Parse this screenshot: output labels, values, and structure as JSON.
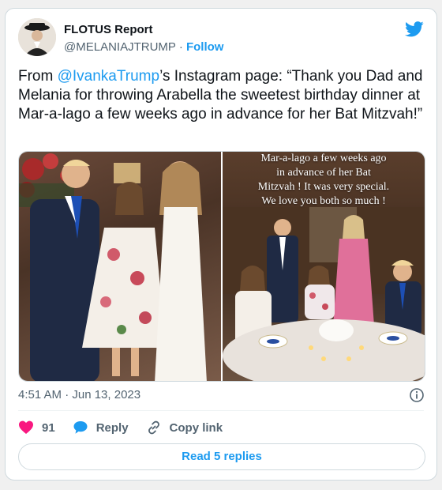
{
  "author": {
    "display_name": "FLOTUS Report",
    "handle": "@MELANIAJTRUMP",
    "separator": "·",
    "follow_label": "Follow",
    "avatar_icon": "user-avatar-icon"
  },
  "tweet": {
    "text_before": "From ",
    "mention": "@IvankaTrump",
    "text_after": "’s Instagram page: “Thank you Dad and Melania for throwing Arabella the sweetest birthday dinner at Mar-a-lago a few weeks ago in advance for her Bat Mitzvah!”",
    "overlay_lines": [
      "Mar-a-lago a few weeks ago",
      "in advance of her Bat",
      "Mitzvah ! It was very special.",
      "We love you both so much  !"
    ],
    "timestamp": "4:51 AM · Jun 13, 2023"
  },
  "actions": {
    "like_count": "91",
    "reply_label": "Reply",
    "copy_link_label": "Copy link",
    "read_replies_label": "Read 5 replies"
  },
  "colors": {
    "accent": "#1d9bf0",
    "like": "#f91880",
    "text": "#0f1419",
    "muted": "#536471"
  }
}
